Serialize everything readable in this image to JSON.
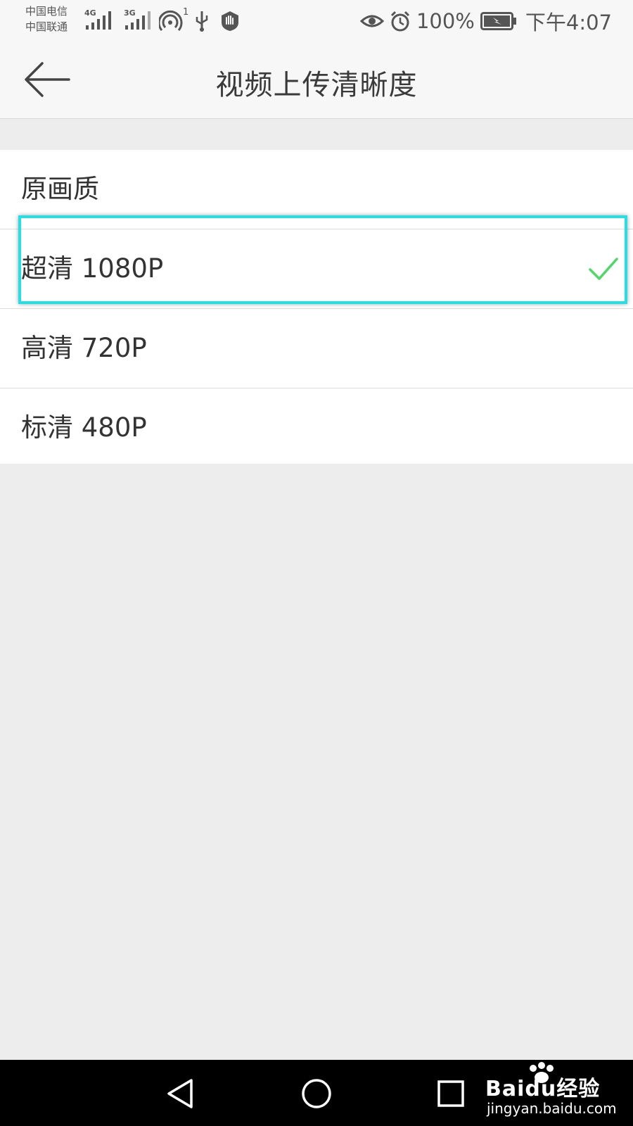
{
  "status_bar": {
    "carrier_1": "中国电信",
    "carrier_2": "中国联通",
    "network_1": "4G",
    "network_2": "3G",
    "hotspot_count": "1",
    "battery": "100%",
    "time": "下午4:07"
  },
  "app_bar": {
    "title": "视频上传清晰度"
  },
  "options": [
    {
      "label": "原画质",
      "selected": false
    },
    {
      "label": "超清 1080P",
      "selected": true
    },
    {
      "label": "高清 720P",
      "selected": false
    },
    {
      "label": "标清 480P",
      "selected": false
    }
  ],
  "colors": {
    "check": "#4cd964",
    "highlight": "#22e0e6",
    "background": "#ededed"
  },
  "watermark": {
    "brand": "Baidu经验",
    "url": "jingyan.baidu.com"
  }
}
